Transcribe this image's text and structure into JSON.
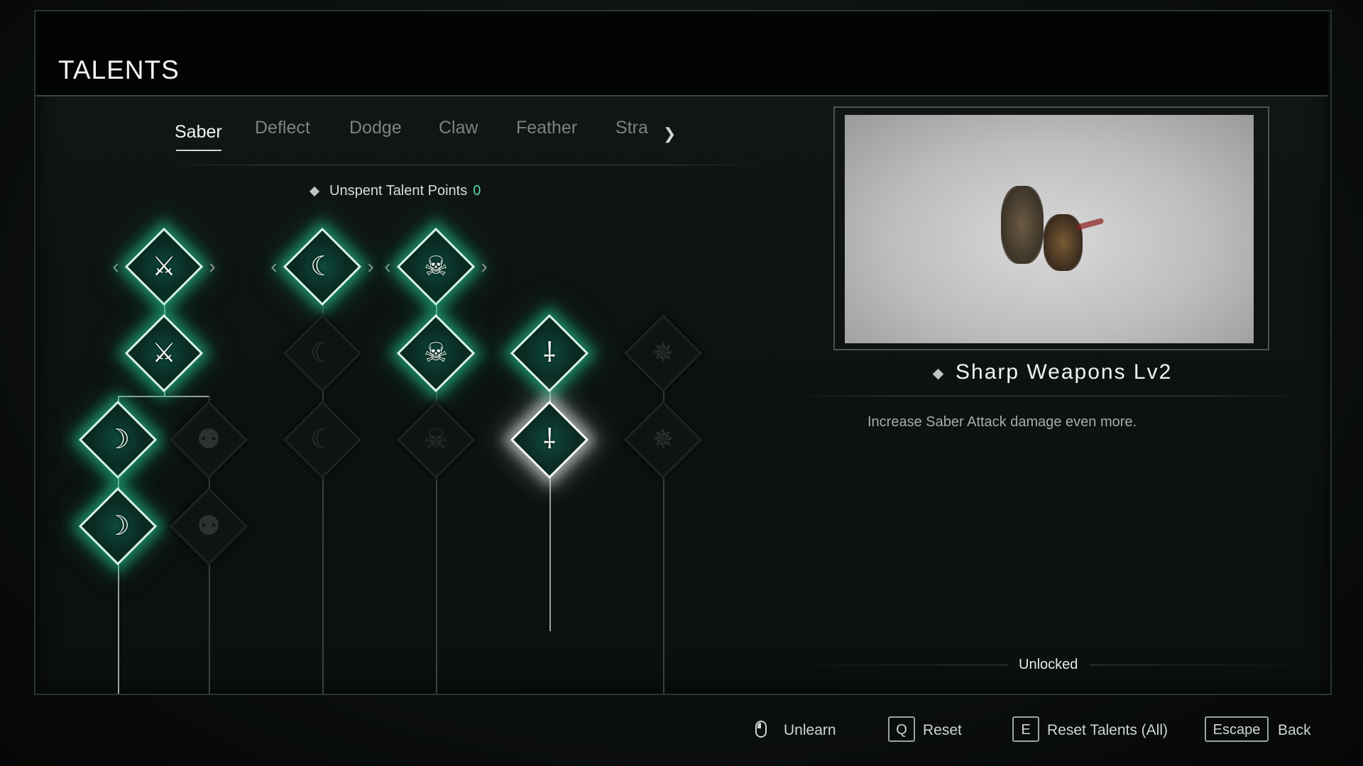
{
  "header": {
    "title": "TALENTS"
  },
  "tabs": [
    {
      "label": "Saber",
      "active": true
    },
    {
      "label": "Deflect"
    },
    {
      "label": "Dodge"
    },
    {
      "label": "Claw"
    },
    {
      "label": "Feather"
    },
    {
      "label": "Stra"
    }
  ],
  "points": {
    "label": "Unspent Talent Points",
    "value": "0"
  },
  "tree": {
    "icons": {
      "blade_swirl": "blade-swirl-icon",
      "talon": "talon-icon",
      "skull_dagger": "skull-dagger-icon",
      "saber": "saber-icon",
      "pinwheel": "pinwheel-icon",
      "crescent": "crescent-slash-icon",
      "claw_man": "clawed-figure-icon"
    }
  },
  "detail": {
    "name": "Sharp Weapons Lv2",
    "description": "Increase Saber Attack damage even more.",
    "status": "Unlocked"
  },
  "footer": {
    "unlearn": "Unlearn",
    "reset_key": "Q",
    "reset": "Reset",
    "reset_all_key": "E",
    "reset_all": "Reset Talents (All)",
    "back_key": "Escape",
    "back": "Back"
  },
  "colors": {
    "accent": "#4fd8a7",
    "glow": "#28d296",
    "selected_glow": "#ffffff"
  }
}
